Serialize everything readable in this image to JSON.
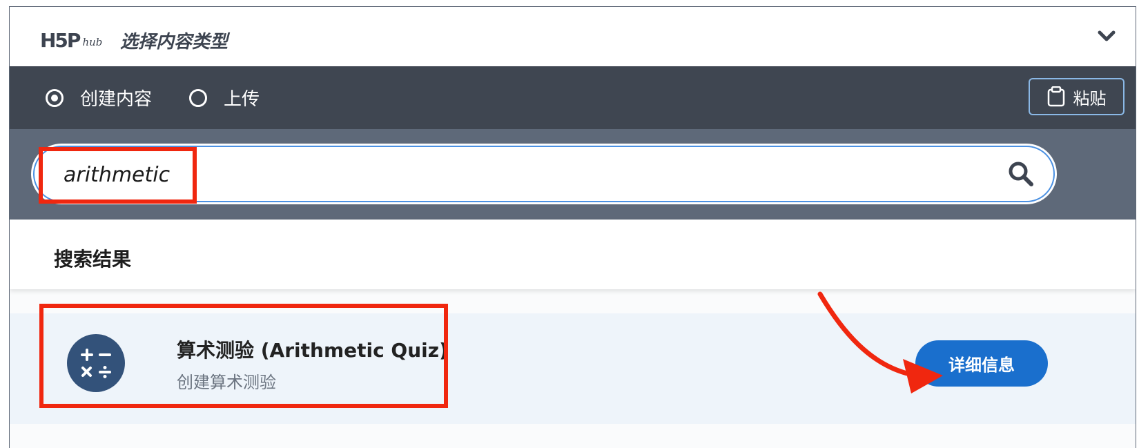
{
  "header": {
    "logo_main": "H5P",
    "logo_sub": "hub",
    "title": "选择内容类型",
    "collapse_icon": "chevron-down-icon"
  },
  "tabs": [
    {
      "label": "创建内容",
      "checked": true
    },
    {
      "label": "上传",
      "checked": false
    }
  ],
  "paste_button": {
    "label": "粘贴",
    "icon": "clipboard-icon"
  },
  "search": {
    "value": "arithmetic",
    "icon": "search-icon"
  },
  "results": {
    "heading": "搜索结果",
    "items": [
      {
        "name": "算术测验 (Arithmetic Quiz)",
        "description": "创建算术测验",
        "icon": "arithmetic-operators-icon",
        "icon_symbols": "+ − × ÷",
        "details_label": "详细信息"
      }
    ]
  },
  "colors": {
    "tab_bar": "#3f4651",
    "search_area": "#5e6979",
    "accent": "#1a6fcd",
    "annotation": "#f0270f"
  }
}
